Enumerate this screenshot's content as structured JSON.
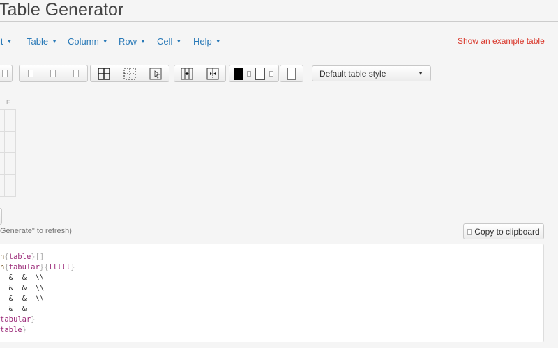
{
  "header": {
    "title": "Table Generator"
  },
  "menu": {
    "items": [
      "it",
      "Table",
      "Column",
      "Row",
      "Cell",
      "Help"
    ],
    "example_link": "Show an example table"
  },
  "toolbar": {
    "style_select": "Default table style"
  },
  "grid": {
    "column_headers": [
      "E"
    ]
  },
  "output": {
    "hint": "Generate\" to refresh)",
    "copy_button": "Copy to clipboard",
    "code_lines": [
      [
        [
          "cm",
          "n"
        ],
        [
          "br",
          "{"
        ],
        [
          "kw",
          "table"
        ],
        [
          "br",
          "}[]"
        ]
      ],
      [
        [
          "cm",
          "n"
        ],
        [
          "br",
          "{"
        ],
        [
          "kw",
          "tabular"
        ],
        [
          "br",
          "}{"
        ],
        [
          "kw",
          "lllll"
        ],
        [
          "br",
          "}"
        ]
      ],
      [
        [
          "",
          "  &  &  \\\\"
        ]
      ],
      [
        [
          "",
          "  &  &  \\\\"
        ]
      ],
      [
        [
          "",
          "  &  &  \\\\"
        ]
      ],
      [
        [
          "",
          "  &  &"
        ]
      ],
      [
        [
          "kw",
          "tabular"
        ],
        [
          "br",
          "}"
        ]
      ],
      [
        [
          "kw",
          "table"
        ],
        [
          "br",
          "}"
        ]
      ]
    ]
  },
  "colors": {
    "link": "#2a7ab8",
    "example": "#d9382c",
    "keyword": "#9b2a78"
  }
}
